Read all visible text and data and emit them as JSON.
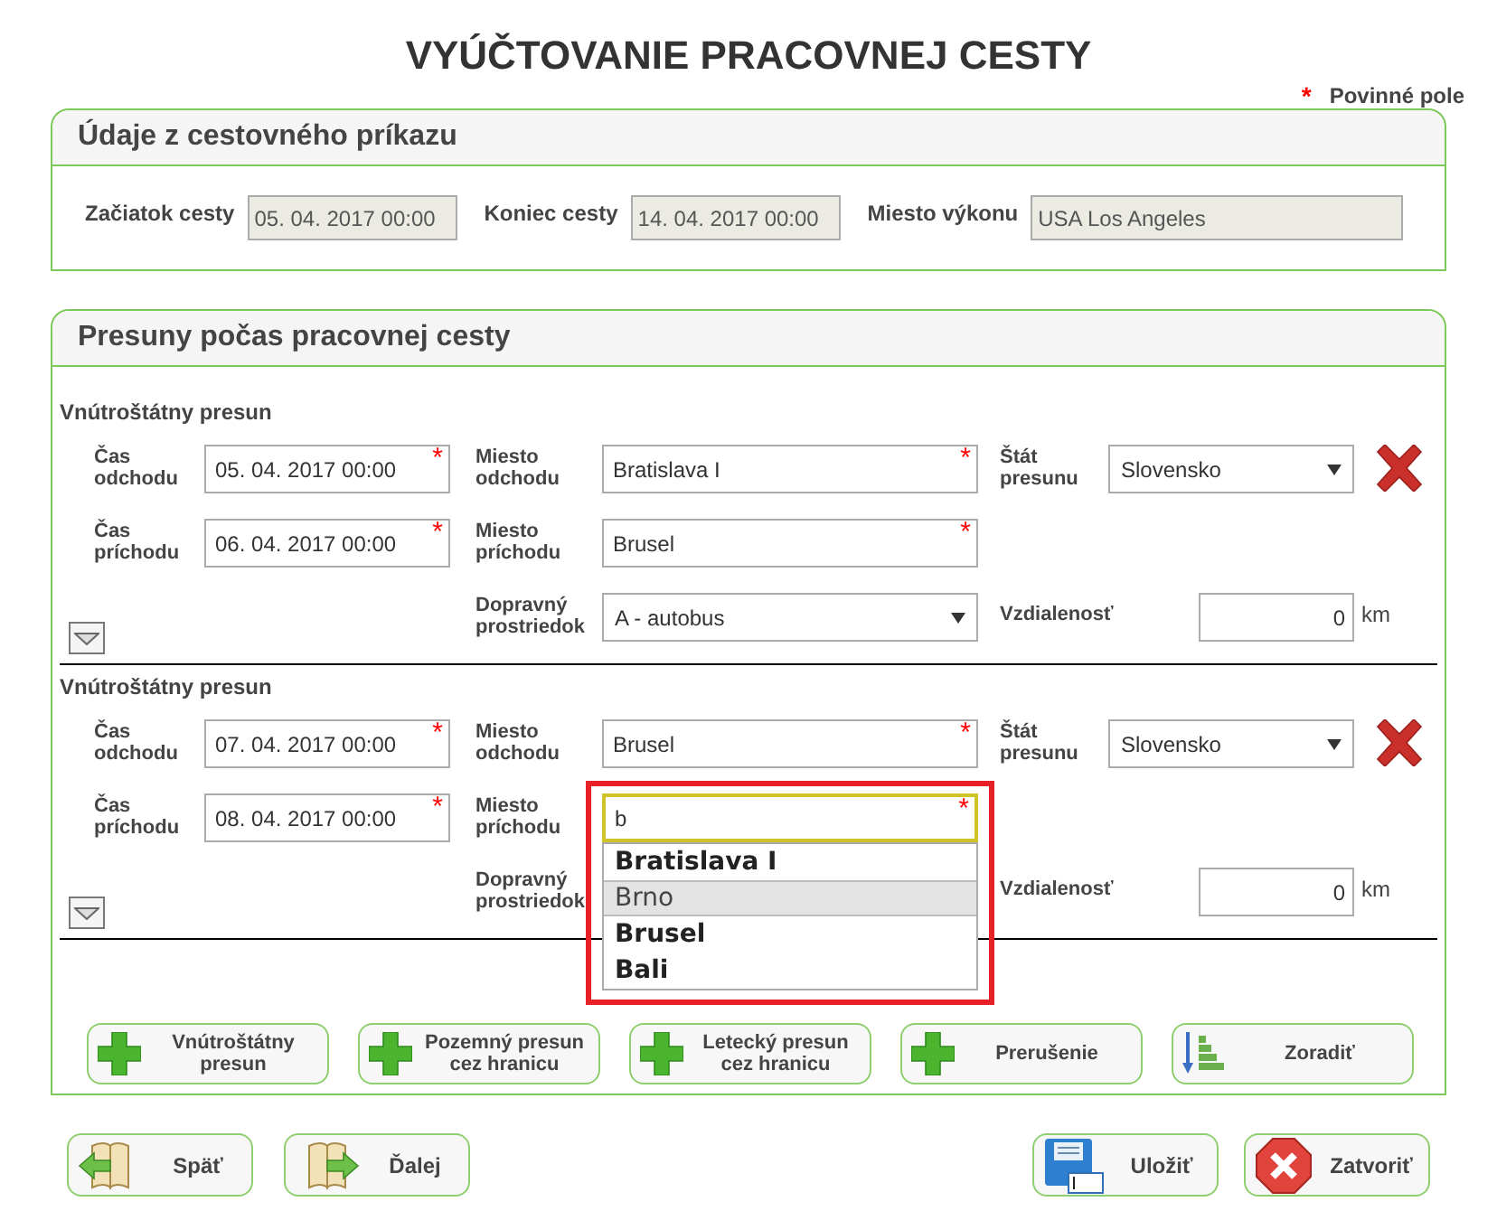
{
  "title": "VYÚČTOVANIE PRACOVNEJ CESTY",
  "required_note": {
    "mark": "*",
    "label": "Povinné pole"
  },
  "order_panel": {
    "title": "Údaje z cestovného príkazu",
    "fields": [
      {
        "label": "Začiatok cesty",
        "value": "05. 04. 2017 00:00"
      },
      {
        "label": "Koniec cesty",
        "value": "14. 04. 2017 00:00"
      },
      {
        "label": "Miesto výkonu",
        "value": "USA Los Angeles"
      }
    ]
  },
  "transfers_panel": {
    "title": "Presuny počas pracovnej cesty",
    "transfers": [
      {
        "heading": "Vnútroštátny presun",
        "departure_time": {
          "label": "Čas odchodu",
          "value": "05. 04. 2017 00:00",
          "required": true
        },
        "departure_place": {
          "label": "Miesto odchodu",
          "value": "Bratislava I",
          "required": true
        },
        "country": {
          "label": "Štát presunu",
          "value": "Slovensko"
        },
        "arrival_time": {
          "label": "Čas príchodu",
          "value": "06. 04. 2017 00:00",
          "required": true
        },
        "arrival_place": {
          "label": "Miesto príchodu",
          "value": "Brusel",
          "required": true,
          "focused": false
        },
        "transport": {
          "label": "Dopravný prostriedok",
          "value": "A - autobus"
        },
        "distance": {
          "label": "Vzdialenosť",
          "value": "0",
          "unit": "km"
        }
      },
      {
        "heading": "Vnútroštátny presun",
        "departure_time": {
          "label": "Čas odchodu",
          "value": "07. 04. 2017 00:00",
          "required": true
        },
        "departure_place": {
          "label": "Miesto odchodu",
          "value": "Brusel",
          "required": true
        },
        "country": {
          "label": "Štát presunu",
          "value": "Slovensko"
        },
        "arrival_time": {
          "label": "Čas príchodu",
          "value": "08. 04. 2017 00:00",
          "required": true
        },
        "arrival_place": {
          "label": "Miesto príchodu",
          "value": "b",
          "required": true,
          "focused": true,
          "annotated": true,
          "suggestions": [
            {
              "label": "Bratislava I",
              "selected": false
            },
            {
              "label": "Brno",
              "selected": true
            },
            {
              "label": "Brusel",
              "selected": false
            },
            {
              "label": "Bali",
              "selected": false
            }
          ]
        },
        "transport": {
          "label": "Dopravný prostriedok"
        },
        "distance": {
          "label": "Vzdialenosť",
          "value": "0",
          "unit": "km"
        }
      }
    ],
    "add_buttons": [
      {
        "label": "Vnútroštátny presun",
        "kind": "plus"
      },
      {
        "label": "Pozemný presun cez hranicu",
        "kind": "plus"
      },
      {
        "label": "Letecký presun cez hranicu",
        "kind": "plus"
      },
      {
        "label": "Prerušenie",
        "kind": "plus"
      },
      {
        "label": "Zoradiť",
        "kind": "sort"
      }
    ]
  },
  "nav_buttons": [
    {
      "label": "Späť",
      "kind": "back"
    },
    {
      "label": "Ďalej",
      "kind": "forward"
    },
    {
      "label": "Uložiť",
      "kind": "save"
    },
    {
      "label": "Zatvoriť",
      "kind": "close"
    }
  ]
}
